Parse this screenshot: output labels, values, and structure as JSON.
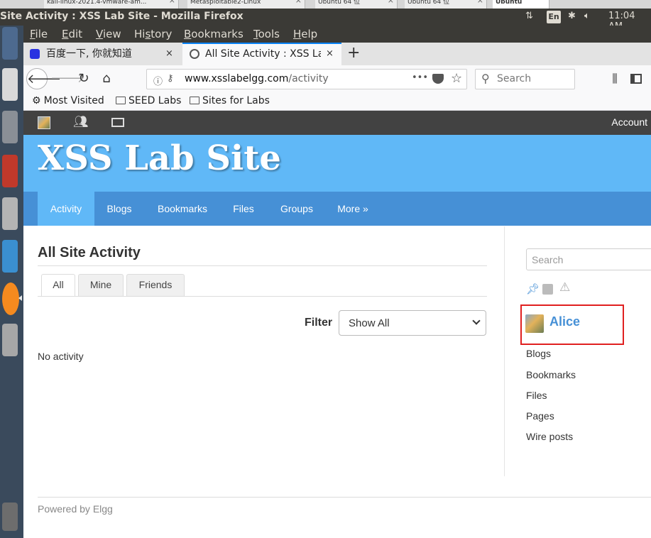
{
  "host_tabs": [
    {
      "label": "kali-linux-2021.4-vmware-am...",
      "close": "×"
    },
    {
      "label": "Metasploitable2-Linux",
      "close": "×"
    },
    {
      "label": "Ubuntu 64 位",
      "close": "×"
    },
    {
      "label": "Ubuntu 64 位",
      "close": "×"
    },
    {
      "label": "Ubuntu",
      "close": ""
    }
  ],
  "ubuntu_panel": {
    "window_title": "Site Activity : XSS Lab Site - Mozilla Firefox",
    "keyboard": "En",
    "clock": "11:04 AM"
  },
  "menubar": [
    {
      "underline": "F",
      "rest": "ile"
    },
    {
      "underline": "E",
      "rest": "dit"
    },
    {
      "underline": "V",
      "rest": "iew"
    },
    {
      "pre": "Hi",
      "underline": "s",
      "rest": "tory"
    },
    {
      "underline": "B",
      "rest": "ookmarks"
    },
    {
      "underline": "T",
      "rest": "ools"
    },
    {
      "underline": "H",
      "rest": "elp"
    }
  ],
  "tabs": [
    {
      "title": "百度一下, 你就知道",
      "close": "×"
    },
    {
      "title": "All Site Activity : XSS Lab",
      "close": "×"
    }
  ],
  "new_tab": "+",
  "urlbar": {
    "host": "www.xsslabelgg.com",
    "path": "/activity",
    "more": "•••"
  },
  "searchbar": {
    "placeholder": "Search"
  },
  "bookmarks": {
    "most_visited": "Most Visited",
    "folder1": "SEED Labs",
    "folder2": "Sites for Labs"
  },
  "topbar": {
    "account": "Account"
  },
  "site": {
    "title": "XSS Lab Site"
  },
  "nav": {
    "items": [
      "Activity",
      "Blogs",
      "Bookmarks",
      "Files",
      "Groups",
      "More »"
    ]
  },
  "main": {
    "heading": "All Site Activity",
    "filter_tabs": [
      "All",
      "Mine",
      "Friends"
    ],
    "filter_label": "Filter",
    "filter_value": "Show All",
    "empty": "No activity"
  },
  "sidebar": {
    "search_placeholder": "Search",
    "owner": "Alice",
    "links": [
      "Blogs",
      "Bookmarks",
      "Files",
      "Pages",
      "Wire posts"
    ]
  },
  "footer": {
    "powered": "Powered by Elgg"
  },
  "colors": {
    "accent_blue": "#4690d6",
    "header_blue": "#60b8f7",
    "highlight_red": "#e02020"
  }
}
